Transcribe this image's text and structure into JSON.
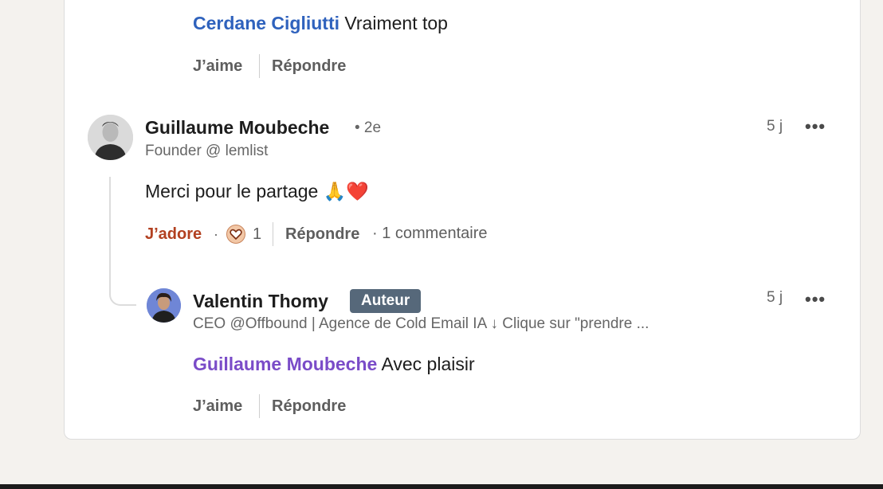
{
  "top_reply": {
    "mention": "Cerdane Cigliutti",
    "text": "Vraiment top",
    "like_label": "J’aime",
    "reply_label": "Répondre"
  },
  "comment": {
    "author": "Guillaume Moubeche",
    "degree": "• 2e",
    "headline": "Founder @ lemlist",
    "time": "5 j",
    "more": "•••",
    "text": "Merci pour le partage 🙏❤️",
    "reaction_label": "J’adore",
    "reaction_dot": "·",
    "reaction_count": "1",
    "reply_label": "Répondre",
    "comments_count": "· 1 commentaire"
  },
  "reply": {
    "author": "Valentin Thomy",
    "badge": "Auteur",
    "headline": "CEO @Offbound | Agence de Cold Email IA ↓ Clique sur \"prendre ...",
    "time": "5 j",
    "more": "•••",
    "mention": "Guillaume Moubeche",
    "text": "Avec plaisir",
    "like_label": "J’aime",
    "reply_label": "Répondre"
  },
  "colors": {
    "mention_blue": "#2f62bd",
    "mention_purple": "#7a4cc8",
    "adore_red": "#b24020",
    "badge_bg": "#56687a"
  }
}
